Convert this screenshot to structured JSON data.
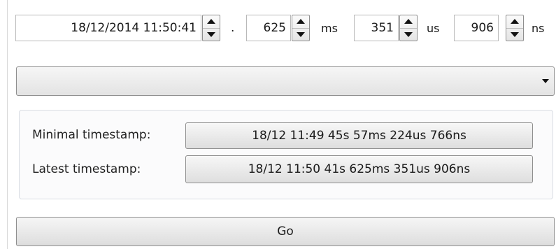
{
  "datetime": {
    "value": "18/12/2014 11:50:41"
  },
  "separator": ".",
  "milliseconds": {
    "value": "625",
    "unit": "ms"
  },
  "microseconds": {
    "value": "351",
    "unit": "us"
  },
  "nanoseconds": {
    "value": "906",
    "unit": "ns"
  },
  "dropdown": {
    "value": ""
  },
  "timestamps": {
    "minimal_label": "Minimal timestamp:",
    "minimal_value": "18/12 11:49 45s 57ms 224us 766ns",
    "latest_label": "Latest timestamp:",
    "latest_value": "18/12 11:50 41s 625ms 351us 906ns"
  },
  "go_label": "Go",
  "icons": {
    "spin_up": "arrow-up-icon",
    "spin_down": "arrow-down-icon",
    "dropdown": "chevron-down-icon"
  }
}
